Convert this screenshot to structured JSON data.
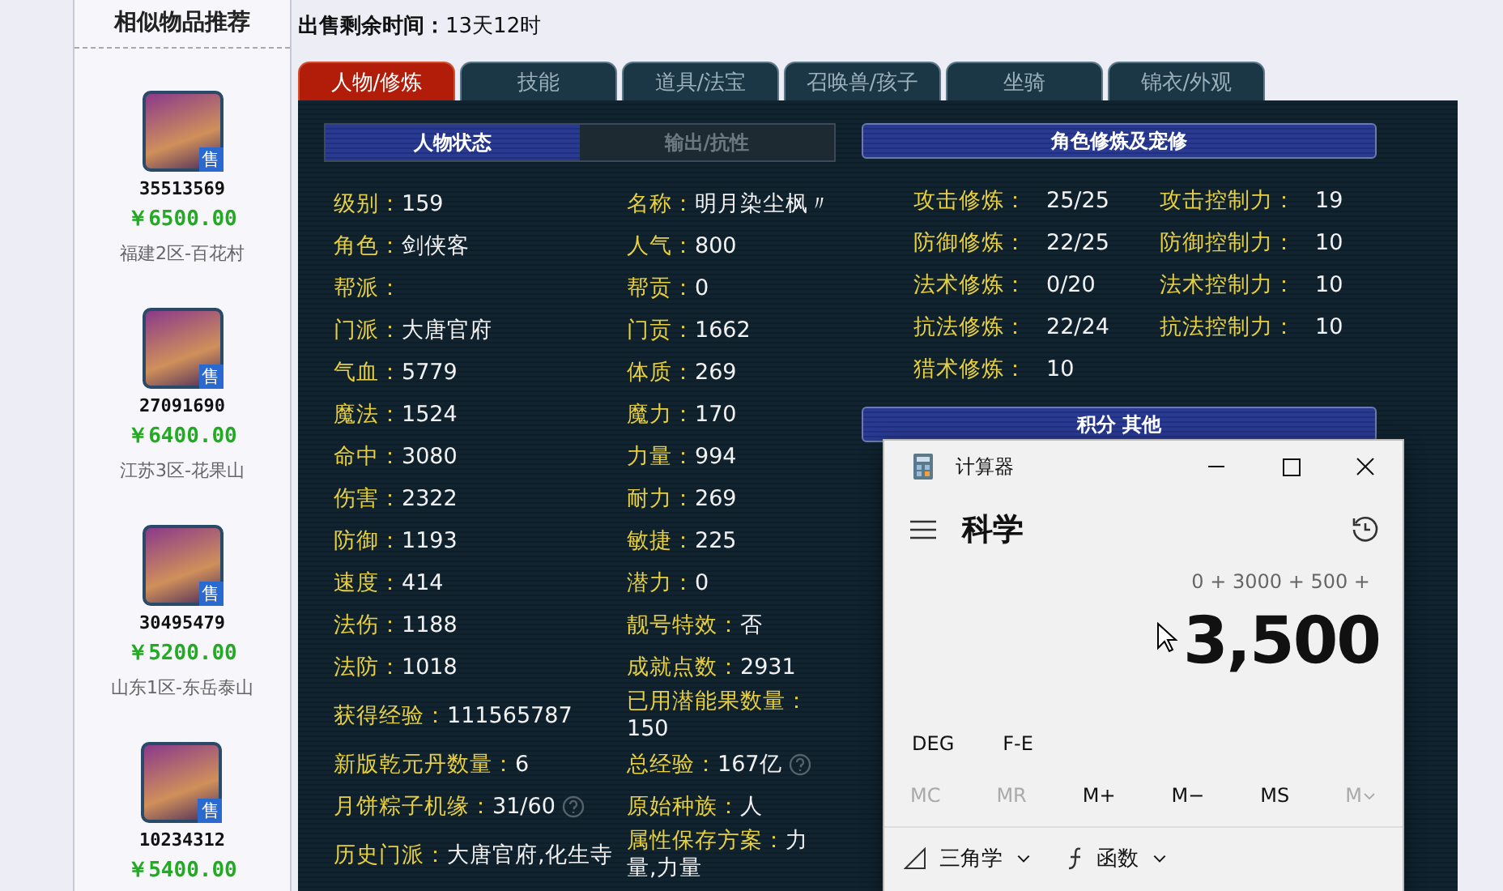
{
  "sidebar": {
    "title": "相似物品推荐",
    "items": [
      {
        "id": "35513569",
        "price": "￥6500.00",
        "server": "福建2区-百花村",
        "badge": "售"
      },
      {
        "id": "27091690",
        "price": "￥6400.00",
        "server": "江苏3区-花果山",
        "badge": "售"
      },
      {
        "id": "30495479",
        "price": "￥5200.00",
        "server": "山东1区-东岳泰山",
        "badge": "售"
      },
      {
        "id": "10234312",
        "price": "￥5400.00",
        "badge": "售"
      }
    ]
  },
  "sale_time": {
    "label": "出售剩余时间：",
    "value": "13天12时"
  },
  "tabs": [
    {
      "label": "人物/修炼",
      "selected": true
    },
    {
      "label": "技能",
      "selected": false
    },
    {
      "label": "道具/法宝",
      "selected": false
    },
    {
      "label": "召唤兽/孩子",
      "selected": false
    },
    {
      "label": "坐骑",
      "selected": false
    },
    {
      "label": "锦衣/外观",
      "selected": false
    }
  ],
  "status_panel": {
    "subtabs": [
      {
        "label": "人物状态",
        "selected": true
      },
      {
        "label": "输出/抗性",
        "selected": false
      }
    ],
    "rows": [
      [
        {
          "label": "级别：",
          "value": "159"
        },
        {
          "label": "名称：",
          "value": "明月染尘枫〃"
        }
      ],
      [
        {
          "label": "角色：",
          "value": "剑侠客"
        },
        {
          "label": "人气：",
          "value": "800"
        }
      ],
      [
        {
          "label": "帮派："
        },
        {
          "label": "帮贡：",
          "value": "0"
        }
      ],
      [
        {
          "label": "门派：",
          "value": "大唐官府"
        },
        {
          "label": "门贡：",
          "value": "1662"
        }
      ],
      [
        {
          "label": "气血：",
          "value": "5779"
        },
        {
          "label": "体质：",
          "value": "269"
        }
      ],
      [
        {
          "label": "魔法：",
          "value": "1524"
        },
        {
          "label": "魔力：",
          "value": "170"
        }
      ],
      [
        {
          "label": "命中：",
          "value": "3080"
        },
        {
          "label": "力量：",
          "value": "994"
        }
      ],
      [
        {
          "label": "伤害：",
          "value": "2322"
        },
        {
          "label": "耐力：",
          "value": "269"
        }
      ],
      [
        {
          "label": "防御：",
          "value": "1193"
        },
        {
          "label": "敏捷：",
          "value": "225"
        }
      ],
      [
        {
          "label": "速度：",
          "value": "414"
        },
        {
          "label": "潜力：",
          "value": "0"
        }
      ],
      [
        {
          "label": "法伤：",
          "value": "1188"
        },
        {
          "label": "靓号特效：",
          "value": "否"
        }
      ],
      [
        {
          "label": "法防：",
          "value": "1018"
        },
        {
          "label": "成就点数：",
          "value": "2931"
        }
      ],
      [
        {
          "label": "获得经验：",
          "value": "111565787"
        },
        {
          "label": "已用潜能果数量：",
          "value": "150"
        }
      ],
      [
        {
          "label": "新版乾元丹数量：",
          "value": "6"
        },
        {
          "label": "总经验：",
          "value": "167亿",
          "help": true
        }
      ],
      [
        {
          "label": "月饼粽子机缘：",
          "value": "31/60",
          "help": true
        },
        {
          "label": "原始种族：",
          "value": "人"
        }
      ],
      [
        {
          "label": "历史门派：",
          "value": "大唐官府,化生寺"
        },
        {
          "label": "属性保存方案：",
          "value": "力量,力量"
        }
      ]
    ]
  },
  "cultivation_panel": {
    "title": "角色修炼及宠修",
    "rows": [
      [
        {
          "label": "攻击修炼：",
          "value": "25/25"
        },
        {
          "label": "攻击控制力：",
          "value": "19"
        }
      ],
      [
        {
          "label": "防御修炼：",
          "value": "22/25"
        },
        {
          "label": "防御控制力：",
          "value": "10"
        }
      ],
      [
        {
          "label": "法术修炼：",
          "value": "0/20"
        },
        {
          "label": "法术控制力：",
          "value": "10"
        }
      ],
      [
        {
          "label": "抗法修炼：",
          "value": "22/24"
        },
        {
          "label": "抗法控制力：",
          "value": "10"
        }
      ],
      [
        {
          "label": "猎术修炼：",
          "value": "10"
        }
      ]
    ],
    "next_title": "积分 其他"
  },
  "calculator": {
    "title": "计算器",
    "mode": "科学",
    "expression": "0 + 3000 + 500 +",
    "display": "3,500",
    "options": [
      "DEG",
      "F-E"
    ],
    "memory": [
      {
        "label": "MC",
        "disabled": true
      },
      {
        "label": "MR",
        "disabled": true
      },
      {
        "label": "M+",
        "disabled": false
      },
      {
        "label": "M−",
        "disabled": false
      },
      {
        "label": "MS",
        "disabled": false
      },
      {
        "label": "M",
        "disabled": true,
        "kind": "dropdown"
      }
    ],
    "menus": [
      {
        "label": "三角学",
        "kind": "trig"
      },
      {
        "label": "函数",
        "kind": "func"
      }
    ]
  }
}
